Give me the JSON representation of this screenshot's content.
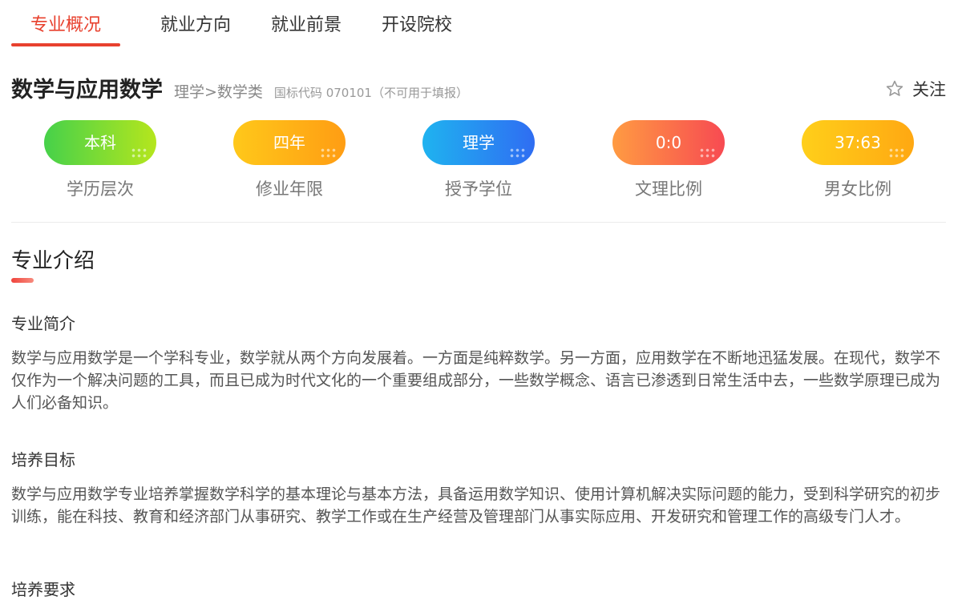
{
  "tabs": [
    {
      "label": "专业概况",
      "active": true
    },
    {
      "label": "就业方向",
      "active": false
    },
    {
      "label": "就业前景",
      "active": false
    },
    {
      "label": "开设院校",
      "active": false
    }
  ],
  "major": {
    "name": "数学与应用数学",
    "category": "理学>数学类",
    "code": "国标代码 070101（不可用于填报）"
  },
  "follow": {
    "icon": "star-outline-icon",
    "label": "关注"
  },
  "stats": [
    {
      "value": "本科",
      "label": "学历层次",
      "gradient": [
        "#46d14a",
        "#b5e61d"
      ]
    },
    {
      "value": "四年",
      "label": "修业年限",
      "gradient": [
        "#ffc81a",
        "#ff9d13"
      ]
    },
    {
      "value": "理学",
      "label": "授予学位",
      "gradient": [
        "#1fb3f0",
        "#2f6df2"
      ]
    },
    {
      "value": "0:0",
      "label": "文理比例",
      "gradient": [
        "#ff9b42",
        "#f74a52"
      ]
    },
    {
      "value": "37:63",
      "label": "男女比例",
      "gradient": [
        "#ffcf1a",
        "#ffa812"
      ]
    }
  ],
  "section": {
    "title": "专业介绍",
    "accent": "#e8412e"
  },
  "blocks": [
    {
      "title": "专业简介",
      "text": "数学与应用数学是一个学科专业，数学就从两个方向发展着。一方面是纯粹数学。另一方面，应用数学在不断地迅猛发展。在现代，数学不仅作为一个解决问题的工具，而且已成为时代文化的一个重要组成部分，一些数学概念、语言已渗透到日常生活中去，一些数学原理已成为人们必备知识。"
    },
    {
      "title": "培养目标",
      "text": "数学与应用数学专业培养掌握数学科学的基本理论与基本方法，具备运用数学知识、使用计算机解决实际问题的能力，受到科学研究的初步训练，能在科技、教育和经济部门从事研究、教学工作或在生产经营及管理部门从事实际应用、开发研究和管理工作的高级专门人才。"
    }
  ],
  "next_block_title": "培养要求"
}
